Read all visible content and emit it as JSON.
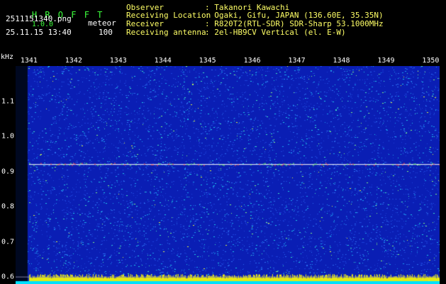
{
  "app": {
    "title": "H R O F F T",
    "version": "1.0.0"
  },
  "file": {
    "name": "2511151340.png",
    "timestamp": "25.11.15 13:40"
  },
  "mode": {
    "label": "meteor",
    "value": "100"
  },
  "info": {
    "observer_label": "Observer",
    "observer_value": ": Takanori Kawachi",
    "location_label": "Receiving Location",
    "location_value": ": Ogaki, Gifu, JAPAN (136.60E, 35.35N)",
    "receiver_label": "Receiver",
    "receiver_value": ": R820T2(RTL-SDR) SDR-Sharp 53.1000MHz",
    "antenna_label": "Receiving antenna",
    "antenna_value": ": 2el-HB9CV Vertical (el. E-W)"
  },
  "colors": {
    "background": "#000000",
    "spectrum_base": "#0a1eb4",
    "trace": "#ffffff",
    "bottom_band": "#ffff00",
    "bottom_fill": "#00e0ff"
  },
  "chart_data": {
    "type": "heatmap",
    "ylabel": "kHz",
    "x_ticks": [
      "1341",
      "1342",
      "1343",
      "1344",
      "1345",
      "1346",
      "1347",
      "1348",
      "1349",
      "1350"
    ],
    "xlim": [
      1340.7,
      1350.2
    ],
    "y_ticks": [
      "1.1",
      "1.0",
      "0.9",
      "0.8",
      "0.7",
      "0.6"
    ],
    "y_values": [
      1.1,
      1.0,
      0.9,
      0.8,
      0.7,
      0.6
    ],
    "ylim": [
      0.58,
      1.2
    ],
    "carrier_khz": 0.92,
    "grid": false
  }
}
